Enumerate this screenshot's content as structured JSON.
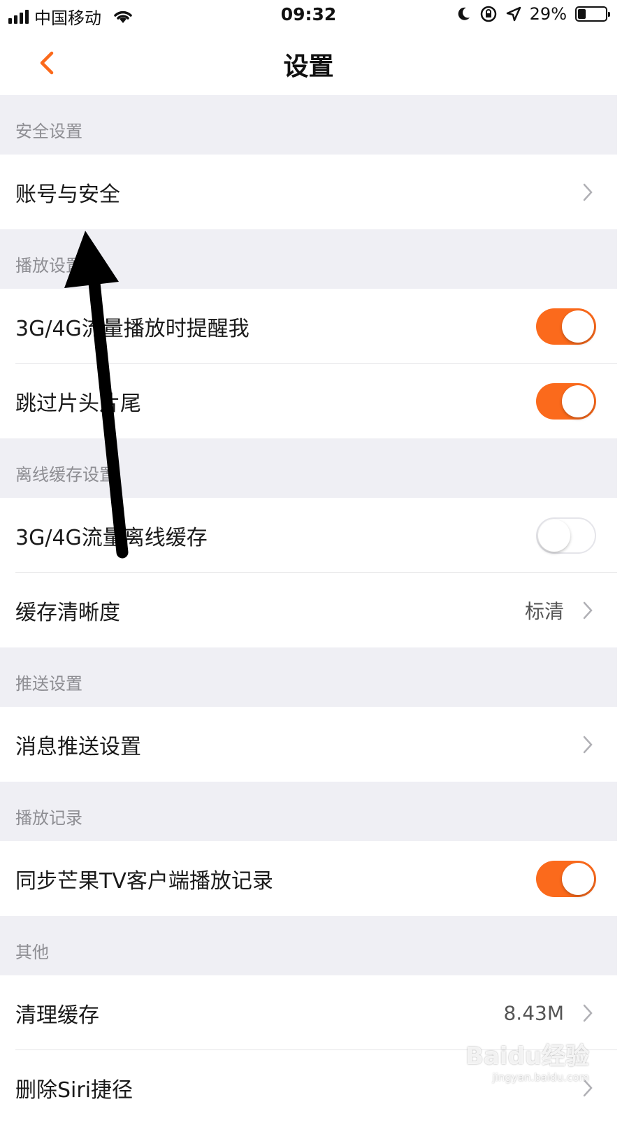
{
  "status_bar": {
    "carrier": "中国移动",
    "time": "09:32",
    "battery_text": "29%",
    "battery_level": 0.29,
    "icons": [
      "signal-icon",
      "wifi-icon",
      "moon-icon",
      "orientation-lock-icon",
      "location-icon",
      "battery-icon"
    ]
  },
  "nav": {
    "title": "设置",
    "back_icon": "chevron-left-icon"
  },
  "sections": {
    "security": {
      "header": "安全设置",
      "account_security": "账号与安全"
    },
    "playback": {
      "header": "播放设置",
      "cellular_remind": {
        "label": "3G/4G流量播放时提醒我",
        "on": true
      },
      "skip_intro": {
        "label": "跳过片头片尾",
        "on": true
      }
    },
    "offline": {
      "header": "离线缓存设置",
      "cellular_cache": {
        "label": "3G/4G流量离线缓存",
        "on": false
      },
      "cache_quality": {
        "label": "缓存清晰度",
        "value": "标清"
      }
    },
    "push": {
      "header": "推送设置",
      "push_settings": "消息推送设置"
    },
    "history": {
      "header": "播放记录",
      "sync_history": {
        "label": "同步芒果TV客户端播放记录",
        "on": true
      }
    },
    "other": {
      "header": "其他",
      "clear_cache": {
        "label": "清理缓存",
        "value": "8.43M"
      },
      "delete_siri": "删除Siri捷径"
    }
  },
  "colors": {
    "accent": "#fb6a1c",
    "section_bg": "#efeff4",
    "section_text": "#8e8e93"
  },
  "watermark": {
    "brand": "Baidu经验",
    "url": "jingyan.baidu.com"
  }
}
